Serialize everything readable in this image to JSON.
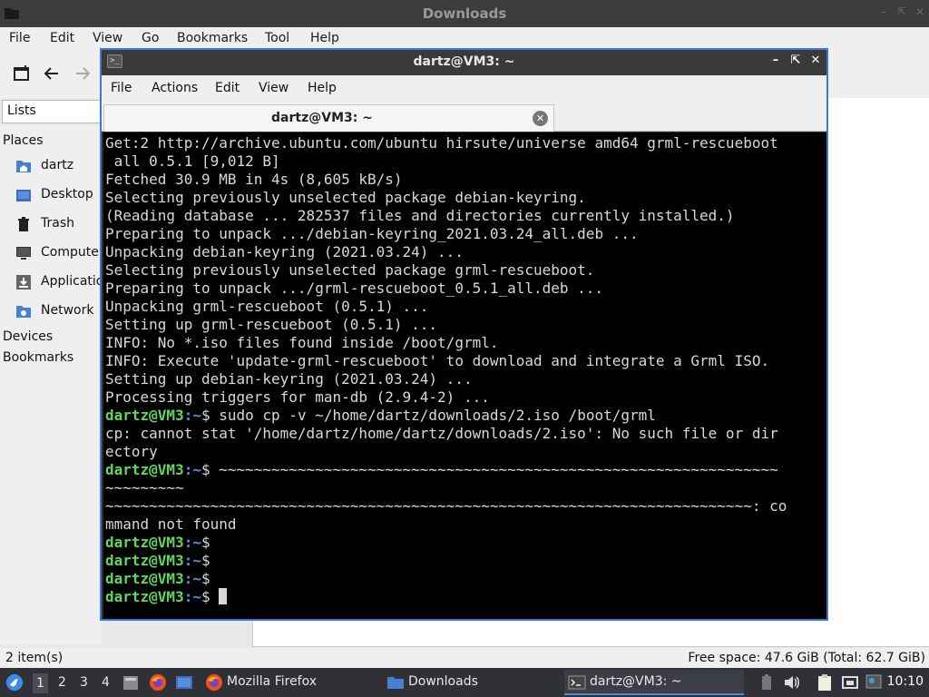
{
  "file_manager": {
    "title": "Downloads",
    "menu": [
      "File",
      "Edit",
      "View",
      "Go",
      "Bookmarks",
      "Tool",
      "Help"
    ],
    "side_combo": "Lists",
    "places_heading": "Places",
    "places": [
      "dartz",
      "Desktop",
      "Trash",
      "Computer",
      "Applications",
      "Network"
    ],
    "devices_heading": "Devices",
    "bookmarks_heading": "Bookmarks",
    "status_left": "2 item(s)",
    "status_right": "Free space: 47.6 GiB (Total: 62.7 GiB)"
  },
  "terminal": {
    "title": "dartz@VM3: ~",
    "menu": [
      "File",
      "Actions",
      "Edit",
      "View",
      "Help"
    ],
    "tab_label": "dartz@VM3: ~",
    "prompt_user": "dartz@VM3",
    "prompt_path": ":~",
    "prompt_symbol": "$",
    "lines": [
      {
        "type": "out",
        "text": "Get:2 http://archive.ubuntu.com/ubuntu hirsute/universe amd64 grml-rescueboot"
      },
      {
        "type": "out",
        "text": " all 0.5.1 [9,012 B]"
      },
      {
        "type": "out",
        "text": "Fetched 30.9 MB in 4s (8,605 kB/s)"
      },
      {
        "type": "out",
        "text": "Selecting previously unselected package debian-keyring."
      },
      {
        "type": "out",
        "text": "(Reading database ... 282537 files and directories currently installed.)"
      },
      {
        "type": "out",
        "text": "Preparing to unpack .../debian-keyring_2021.03.24_all.deb ..."
      },
      {
        "type": "out",
        "text": "Unpacking debian-keyring (2021.03.24) ..."
      },
      {
        "type": "out",
        "text": "Selecting previously unselected package grml-rescueboot."
      },
      {
        "type": "out",
        "text": "Preparing to unpack .../grml-rescueboot_0.5.1_all.deb ..."
      },
      {
        "type": "out",
        "text": "Unpacking grml-rescueboot (0.5.1) ..."
      },
      {
        "type": "out",
        "text": "Setting up grml-rescueboot (0.5.1) ..."
      },
      {
        "type": "out",
        "text": "INFO: No *.iso files found inside /boot/grml."
      },
      {
        "type": "out",
        "text": "INFO: Execute 'update-grml-rescueboot' to download and integrate a Grml ISO."
      },
      {
        "type": "out",
        "text": "Setting up debian-keyring (2021.03.24) ..."
      },
      {
        "type": "out",
        "text": "Processing triggers for man-db (2.9.4-2) ..."
      },
      {
        "type": "cmd",
        "text": " sudo cp -v ~/home/dartz/downloads/2.iso /boot/grml"
      },
      {
        "type": "out",
        "text": "cp: cannot stat '/home/dartz/home/dartz/downloads/2.iso': No such file or dir"
      },
      {
        "type": "out",
        "text": "ectory"
      },
      {
        "type": "cmd",
        "text": " ~~~~~~~~~~~~~~~~~~~~~~~~~~~~~~~~~~~~~~~~~~~~~~~~~~~~~~~~~~~~~~~~"
      },
      {
        "type": "out",
        "text": "~~~~~~~~~"
      },
      {
        "type": "out",
        "text": "~~~~~~~~~~~~~~~~~~~~~~~~~~~~~~~~~~~~~~~~~~~~~~~~~~~~~~~~~~~~~~~~~~~~~~~~~~: co"
      },
      {
        "type": "out",
        "text": "mmand not found"
      },
      {
        "type": "cmd",
        "text": ""
      },
      {
        "type": "cmd",
        "text": ""
      },
      {
        "type": "cmd",
        "text": ""
      },
      {
        "type": "cmd",
        "text": " ",
        "cursor": true
      }
    ]
  },
  "taskbar": {
    "workspaces": [
      "1",
      "2",
      "3",
      "4"
    ],
    "tasks": [
      {
        "label": "Mozilla Firefox",
        "icon": "firefox-icon"
      },
      {
        "label": "Downloads",
        "icon": "folder-icon"
      },
      {
        "label": "dartz@VM3: ~",
        "icon": "terminal-icon"
      }
    ],
    "clock": "10:10"
  }
}
